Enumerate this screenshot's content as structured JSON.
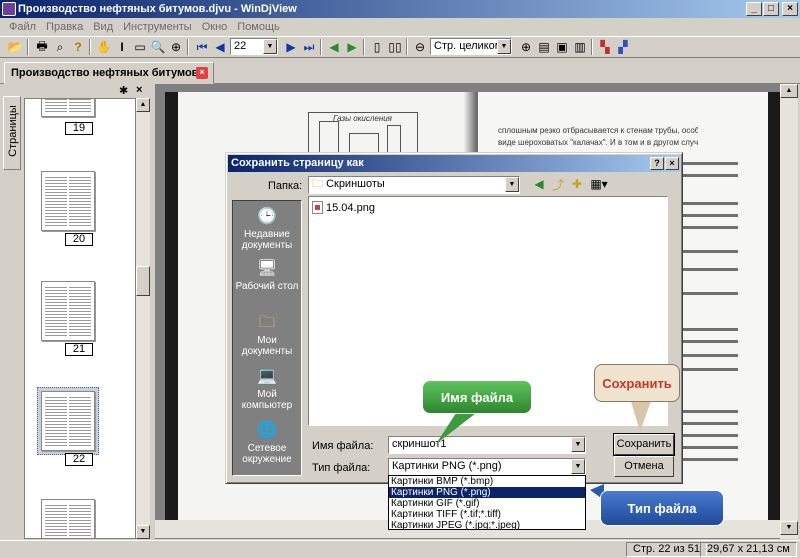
{
  "window": {
    "title": "Производство нефтяных битумов.djvu - WinDjView",
    "min": "_",
    "max": "□",
    "close": "×"
  },
  "menu": [
    "Файл",
    "Правка",
    "Вид",
    "Инструменты",
    "Окно",
    "Помощь"
  ],
  "toolbar": {
    "page_value": "22",
    "zoom_value": "Стр. целиком"
  },
  "tab": {
    "label": "Производство нефтяных битумов...",
    "close": "×"
  },
  "sidebar": {
    "tab_label": "Страницы",
    "thumbnails": [
      "19",
      "20",
      "21",
      "22"
    ]
  },
  "status": {
    "page": "Стр. 22 из 51",
    "size": "29,67 x 21,13 см"
  },
  "dialog": {
    "title": "Сохранить страницу как",
    "help": "?",
    "close": "×",
    "folder_label": "Папка:",
    "folder_value": "Скриншоты",
    "files": [
      "15.04.png"
    ],
    "places": [
      "Недавние документы",
      "Рабочий стол",
      "Мои документы",
      "Мой компьютер",
      "Сетевое окружение"
    ],
    "filename_label": "Имя файла:",
    "filename_value": "скриншот1",
    "filetype_label": "Тип файла:",
    "filetype_value": "Картинки PNG (*.png)",
    "save_button": "Сохранить",
    "cancel_button": "Отмена",
    "filetype_options": [
      "Картинки BMP (*.bmp)",
      "Картинки PNG (*.png)",
      "Картинки GIF (*.gif)",
      "Картинки TIFF (*.tif;*.tiff)",
      "Картинки JPEG (*.jpg;*.jpeg)"
    ]
  },
  "callouts": {
    "filename": "Имя файла",
    "save": "Сохранить",
    "filetype": "Тип файла"
  },
  "page_text": {
    "line1": "сплошным резко отбрасывается к стенам трубы, особенно в",
    "line2": "виде шероховатых \"калачах\". И в том и в другом случае улучшается",
    "fig_label": "Газы окисления"
  },
  "colors": {
    "titlebar": "#0a246a",
    "callout_green": "#3d9a3d",
    "callout_blue": "#2a5aa8",
    "callout_save_text": "#c0392b"
  }
}
